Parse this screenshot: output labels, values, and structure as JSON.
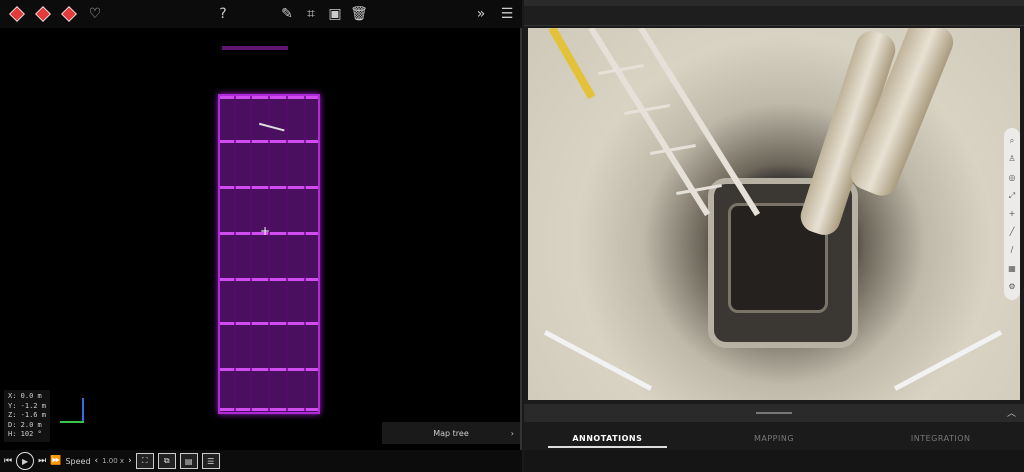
{
  "left_toolbar": {
    "help_label": "?",
    "icons": [
      "red-cube-icon",
      "red-cube-icon",
      "red-cube-icon",
      "heart-icon",
      "pencil-icon",
      "crop-icon",
      "save-icon",
      "trash-icon",
      "double-chevron-right-icon",
      "panel-toggle-icon"
    ]
  },
  "coords": {
    "x": "X: 0.0 m",
    "y": "Y: -1.2 m",
    "z": "Z: -1.6 m",
    "d": "D: 2.0 m",
    "h": "H: 102 °"
  },
  "map_tree": {
    "label": "Map tree",
    "chevron": "›"
  },
  "controls": {
    "speed_label": "Speed",
    "speed_value": "1.00 x",
    "buttons": [
      "skip-back-icon",
      "play-icon",
      "skip-forward-icon",
      "fast-forward-icon"
    ]
  },
  "tabs": [
    {
      "label": "ANNOTATIONS",
      "active": true
    },
    {
      "label": "MAPPING",
      "active": false
    },
    {
      "label": "INTEGRATION",
      "active": false
    }
  ],
  "colors": {
    "pointcloud": "#b02bd8",
    "accent": "#e23b3b"
  }
}
